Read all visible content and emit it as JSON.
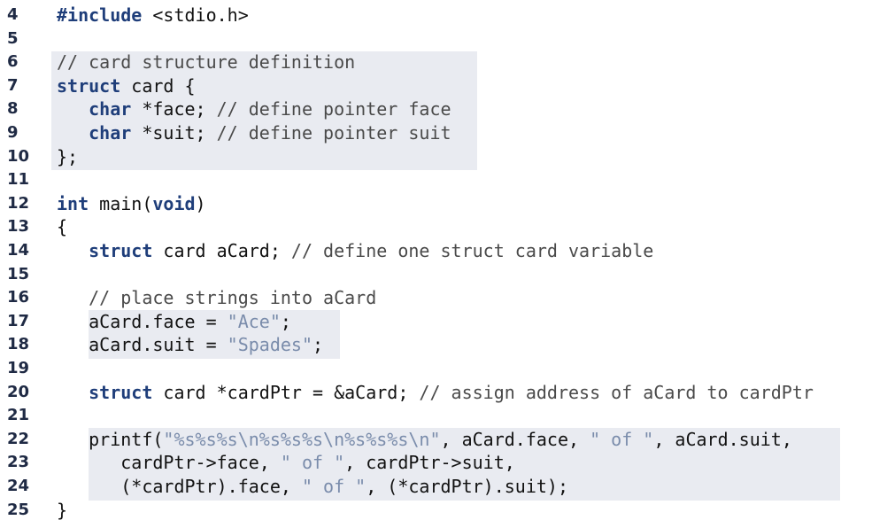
{
  "code_lines": [
    {
      "number": "4",
      "tokens": [
        {
          "t": "#include",
          "c": "pp"
        },
        {
          "t": " <stdio.h>",
          "c": "plain"
        }
      ]
    },
    {
      "number": "5",
      "tokens": []
    },
    {
      "number": "6",
      "tokens": [
        {
          "t": "// card structure definition",
          "c": "cm"
        }
      ]
    },
    {
      "number": "7",
      "tokens": [
        {
          "t": "struct",
          "c": "kw"
        },
        {
          "t": " card {",
          "c": "plain"
        }
      ]
    },
    {
      "number": "8",
      "tokens": [
        {
          "t": "   ",
          "c": "plain"
        },
        {
          "t": "char",
          "c": "kw"
        },
        {
          "t": " *face; ",
          "c": "plain"
        },
        {
          "t": "// define pointer face",
          "c": "cm"
        }
      ]
    },
    {
      "number": "9",
      "tokens": [
        {
          "t": "   ",
          "c": "plain"
        },
        {
          "t": "char",
          "c": "kw"
        },
        {
          "t": " *suit; ",
          "c": "plain"
        },
        {
          "t": "// define pointer suit",
          "c": "cm"
        }
      ]
    },
    {
      "number": "10",
      "tokens": [
        {
          "t": "};",
          "c": "plain"
        }
      ]
    },
    {
      "number": "11",
      "tokens": []
    },
    {
      "number": "12",
      "tokens": [
        {
          "t": "int",
          "c": "kw"
        },
        {
          "t": " main(",
          "c": "plain"
        },
        {
          "t": "void",
          "c": "kw"
        },
        {
          "t": ")",
          "c": "plain"
        }
      ]
    },
    {
      "number": "13",
      "tokens": [
        {
          "t": "{",
          "c": "plain"
        }
      ]
    },
    {
      "number": "14",
      "tokens": [
        {
          "t": "   ",
          "c": "plain"
        },
        {
          "t": "struct",
          "c": "kw"
        },
        {
          "t": " card aCard; ",
          "c": "plain"
        },
        {
          "t": "// define one struct card variable",
          "c": "cm"
        }
      ]
    },
    {
      "number": "15",
      "tokens": []
    },
    {
      "number": "16",
      "tokens": [
        {
          "t": "   ",
          "c": "plain"
        },
        {
          "t": "// place strings into aCard",
          "c": "cm"
        }
      ]
    },
    {
      "number": "17",
      "tokens": [
        {
          "t": "   aCard.face = ",
          "c": "plain"
        },
        {
          "t": "\"Ace\"",
          "c": "str"
        },
        {
          "t": ";",
          "c": "plain"
        }
      ]
    },
    {
      "number": "18",
      "tokens": [
        {
          "t": "   aCard.suit = ",
          "c": "plain"
        },
        {
          "t": "\"Spades\"",
          "c": "str"
        },
        {
          "t": ";",
          "c": "plain"
        }
      ]
    },
    {
      "number": "19",
      "tokens": []
    },
    {
      "number": "20",
      "tokens": [
        {
          "t": "   ",
          "c": "plain"
        },
        {
          "t": "struct",
          "c": "kw"
        },
        {
          "t": " card *cardPtr = &aCard; ",
          "c": "plain"
        },
        {
          "t": "// assign address of aCard to cardPtr",
          "c": "cm"
        }
      ]
    },
    {
      "number": "21",
      "tokens": []
    },
    {
      "number": "22",
      "tokens": [
        {
          "t": "   printf(",
          "c": "plain"
        },
        {
          "t": "\"%s%s%s\\n%s%s%s\\n%s%s%s\\n\"",
          "c": "str"
        },
        {
          "t": ", aCard.face, ",
          "c": "plain"
        },
        {
          "t": "\" of \"",
          "c": "str"
        },
        {
          "t": ", aCard.suit,",
          "c": "plain"
        }
      ]
    },
    {
      "number": "23",
      "tokens": [
        {
          "t": "      cardPtr->face, ",
          "c": "plain"
        },
        {
          "t": "\" of \"",
          "c": "str"
        },
        {
          "t": ", cardPtr->suit,",
          "c": "plain"
        }
      ]
    },
    {
      "number": "24",
      "tokens": [
        {
          "t": "      (*cardPtr).face, ",
          "c": "plain"
        },
        {
          "t": "\" of \"",
          "c": "str"
        },
        {
          "t": ", (*cardPtr).suit);",
          "c": "plain"
        }
      ]
    },
    {
      "number": "25",
      "tokens": [
        {
          "t": "}",
          "c": "plain"
        }
      ]
    }
  ],
  "highlight_color": "#e9ebf1"
}
